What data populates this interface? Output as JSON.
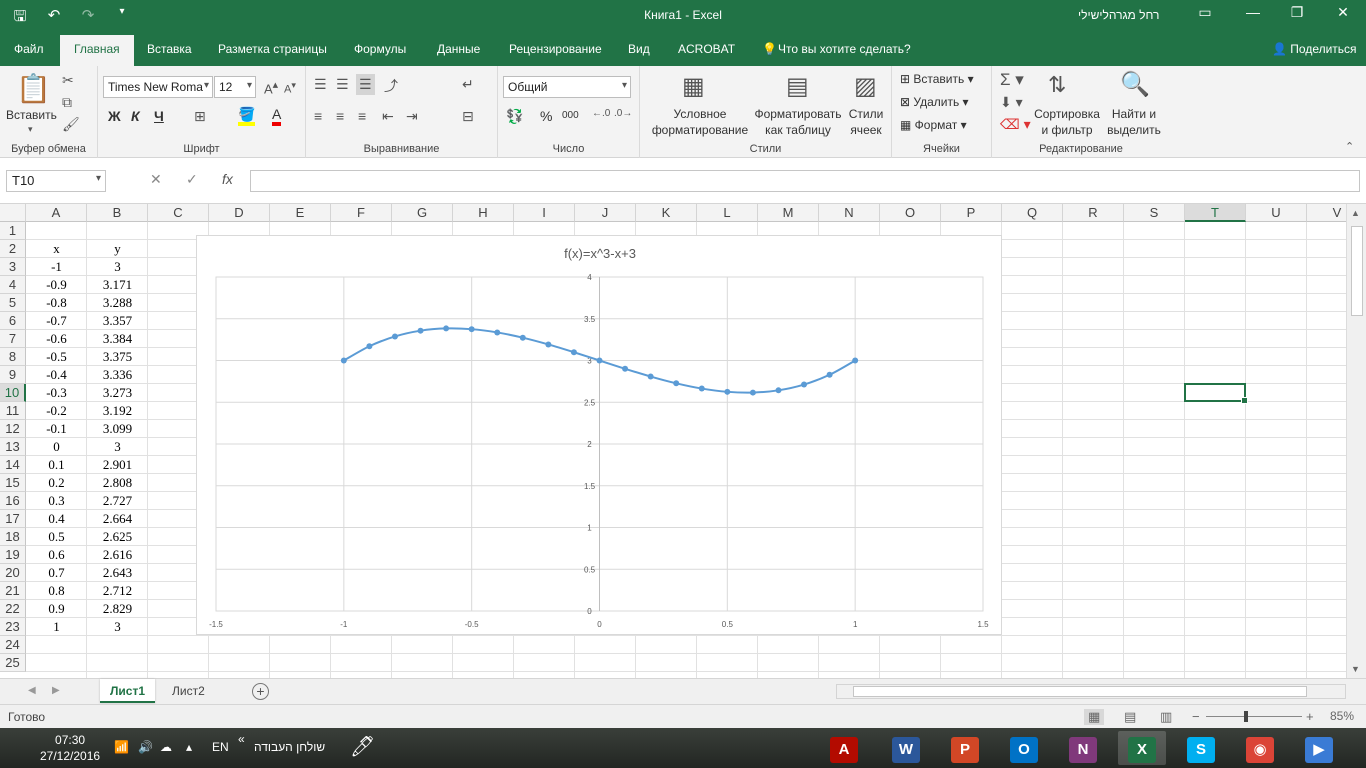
{
  "window": {
    "title": "Книга1  -  Excel",
    "user": "רחל מגרהלישילי",
    "qat_icons": [
      "save-icon",
      "undo-icon",
      "redo-icon",
      "customize-icon"
    ]
  },
  "tabs": [
    {
      "id": "file",
      "label": "Файл"
    },
    {
      "id": "home",
      "label": "Главная",
      "active": true
    },
    {
      "id": "insert",
      "label": "Вставка"
    },
    {
      "id": "layout",
      "label": "Разметка страницы"
    },
    {
      "id": "formulas",
      "label": "Формулы"
    },
    {
      "id": "data",
      "label": "Данные"
    },
    {
      "id": "review",
      "label": "Рецензирование"
    },
    {
      "id": "view",
      "label": "Вид"
    },
    {
      "id": "acrobat",
      "label": "ACROBAT"
    },
    {
      "id": "tellme",
      "label": "Что вы хотите сделать?"
    }
  ],
  "share_label": "Поделиться",
  "ribbon": {
    "clipboard": {
      "label": "Буфер обмена",
      "paste": "Вставить"
    },
    "font": {
      "label": "Шрифт",
      "font_name": "Times New Roma",
      "font_size": "12",
      "bold": "Ж",
      "italic": "К",
      "underline": "Ч"
    },
    "alignment": {
      "label": "Выравнивание"
    },
    "number": {
      "label": "Число",
      "format": "Общий",
      "percent": "%",
      "thousands": "000"
    },
    "styles": {
      "label": "Стили",
      "conditional": [
        "Условное",
        "форматирование"
      ],
      "as_table": [
        "Форматировать",
        "как таблицу"
      ],
      "cell_styles": [
        "Стили",
        "ячеек"
      ]
    },
    "cells": {
      "label": "Ячейки",
      "insert": "Вставить",
      "delete": "Удалить",
      "format": "Формат"
    },
    "editing": {
      "label": "Редактирование",
      "sort": [
        "Сортировка",
        "и фильтр"
      ],
      "find": [
        "Найти и",
        "выделить"
      ]
    }
  },
  "formula_bar": {
    "name_box": "T10",
    "fx": "fx",
    "formula": ""
  },
  "columns": [
    "A",
    "B",
    "C",
    "D",
    "E",
    "F",
    "G",
    "H",
    "I",
    "J",
    "K",
    "L",
    "M",
    "N",
    "O",
    "P",
    "Q",
    "R",
    "S",
    "T",
    "U",
    "V"
  ],
  "rows": [
    "1",
    "2",
    "3",
    "4",
    "5",
    "6",
    "7",
    "8",
    "9",
    "10",
    "11",
    "12",
    "13",
    "14",
    "15",
    "16",
    "17",
    "18",
    "19",
    "20",
    "21",
    "22",
    "23",
    "24",
    "25"
  ],
  "selected": {
    "col": "T",
    "row": "10"
  },
  "cells": {
    "A": [
      "",
      "x",
      "-1",
      "-0.9",
      "-0.8",
      "-0.7",
      "-0.6",
      "-0.5",
      "-0.4",
      "-0.3",
      "-0.2",
      "-0.1",
      "0",
      "0.1",
      "0.2",
      "0.3",
      "0.4",
      "0.5",
      "0.6",
      "0.7",
      "0.8",
      "0.9",
      "1"
    ],
    "B": [
      "",
      "y",
      "3",
      "3.171",
      "3.288",
      "3.357",
      "3.384",
      "3.375",
      "3.336",
      "3.273",
      "3.192",
      "3.099",
      "3",
      "2.901",
      "2.808",
      "2.727",
      "2.664",
      "2.625",
      "2.616",
      "2.643",
      "2.712",
      "2.829",
      "3"
    ]
  },
  "chart_data": {
    "type": "scatter",
    "title": "f(x)=x^3-x+3",
    "smooth": true,
    "x": [
      -1,
      -0.9,
      -0.8,
      -0.7,
      -0.6,
      -0.5,
      -0.4,
      -0.3,
      -0.2,
      -0.1,
      0,
      0.1,
      0.2,
      0.3,
      0.4,
      0.5,
      0.6,
      0.7,
      0.8,
      0.9,
      1
    ],
    "y": [
      3,
      3.171,
      3.288,
      3.357,
      3.384,
      3.375,
      3.336,
      3.273,
      3.192,
      3.099,
      3,
      2.901,
      2.808,
      2.727,
      2.664,
      2.625,
      2.616,
      2.643,
      2.712,
      2.829,
      3
    ],
    "xlim": [
      -1.5,
      1.5
    ],
    "ylim": [
      0,
      4
    ],
    "xticks": [
      "-1.5",
      "-1",
      "-0.5",
      "0",
      "0.5",
      "1",
      "1.5"
    ],
    "yticks": [
      "0",
      "0.5",
      "1",
      "1.5",
      "2",
      "2.5",
      "3",
      "3.5",
      "4"
    ],
    "grid": true,
    "series_color": "#5b9bd5"
  },
  "sheets": [
    {
      "label": "Лист1",
      "active": true
    },
    {
      "label": "Лист2"
    }
  ],
  "status": {
    "text": "Готово",
    "zoom": "85%",
    "zoom_minus": "−",
    "zoom_plus": "+"
  },
  "taskbar": {
    "time": "07:30",
    "date": "27/12/2016",
    "lang": "EN",
    "toolbar_label": "שולחן העבודה",
    "apps": [
      {
        "name": "acrobat",
        "glyph": "A",
        "color": "#b30b00"
      },
      {
        "name": "word",
        "glyph": "W",
        "color": "#2b579a"
      },
      {
        "name": "powerpoint",
        "glyph": "P",
        "color": "#d24726"
      },
      {
        "name": "outlook",
        "glyph": "O",
        "color": "#0072c6"
      },
      {
        "name": "onenote",
        "glyph": "N",
        "color": "#80397b"
      },
      {
        "name": "excel",
        "glyph": "X",
        "color": "#217346",
        "active": true
      },
      {
        "name": "skype",
        "glyph": "S",
        "color": "#00aff0"
      },
      {
        "name": "chrome",
        "glyph": "◉",
        "color": "#db4437"
      },
      {
        "name": "windows-media",
        "glyph": "▶",
        "color": "#3a7bd5"
      }
    ]
  }
}
